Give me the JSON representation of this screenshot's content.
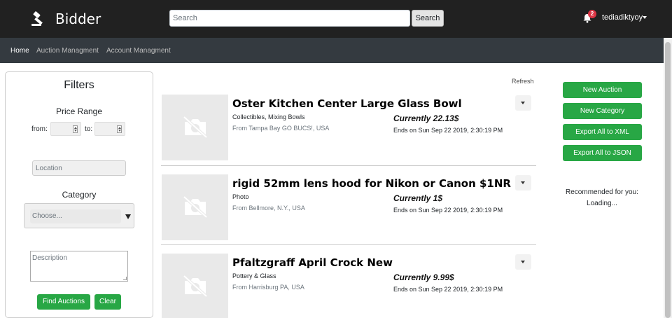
{
  "app": {
    "brand": "Bidder"
  },
  "header": {
    "search_placeholder": "Search",
    "search_button": "Search",
    "notification_count": "2",
    "username": "tediadiktyoy"
  },
  "subnav": {
    "items": [
      "Home",
      "Auction Managment",
      "Account Managment"
    ]
  },
  "filters": {
    "title": "Filters",
    "price_range_label": "Price Range",
    "from_label": "from:",
    "to_label": "to:",
    "location_placeholder": "Location",
    "category_label": "Category",
    "category_selected": "Choose...",
    "description_placeholder": "Description",
    "find_button": "Find Auctions",
    "clear_button": "Clear"
  },
  "listings": {
    "refresh_label": "Refresh",
    "items": [
      {
        "title": "Oster Kitchen Center Large Glass Bowl",
        "category": "Collectibles, Mixing Bowls",
        "location": "From Tampa Bay GO BUCS!, USA",
        "price": "Currently 22.13$",
        "ends": "Ends on Sun Sep 22 2019, 2:30:19 PM"
      },
      {
        "title": "rigid 52mm lens hood for Nikon or Canon $1NR",
        "category": "Photo",
        "location": "From Bellmore, N.Y., USA",
        "price": "Currently 1$",
        "ends": "Ends on Sun Sep 22 2019, 2:30:19 PM"
      },
      {
        "title": "Pfaltzgraff April Crock New",
        "category": "Pottery & Glass",
        "location": "From Harrisburg PA, USA",
        "price": "Currently 9.99$",
        "ends": "Ends on Sun Sep 22 2019, 2:30:19 PM"
      }
    ]
  },
  "actions": {
    "new_auction": "New Auction",
    "new_category": "New Category",
    "export_xml": "Export All to XML",
    "export_json": "Export All to JSON"
  },
  "recommendations": {
    "title": "Recommended for you:",
    "status": "Loading..."
  },
  "colors": {
    "navbar": "#212121",
    "subnav": "#343a40",
    "accent_green": "#28a745",
    "badge_red": "#dc3545"
  },
  "icons": {
    "brand": "gavel-icon",
    "notifications": "bell-icon",
    "thumbnail": "no-camera-icon"
  }
}
